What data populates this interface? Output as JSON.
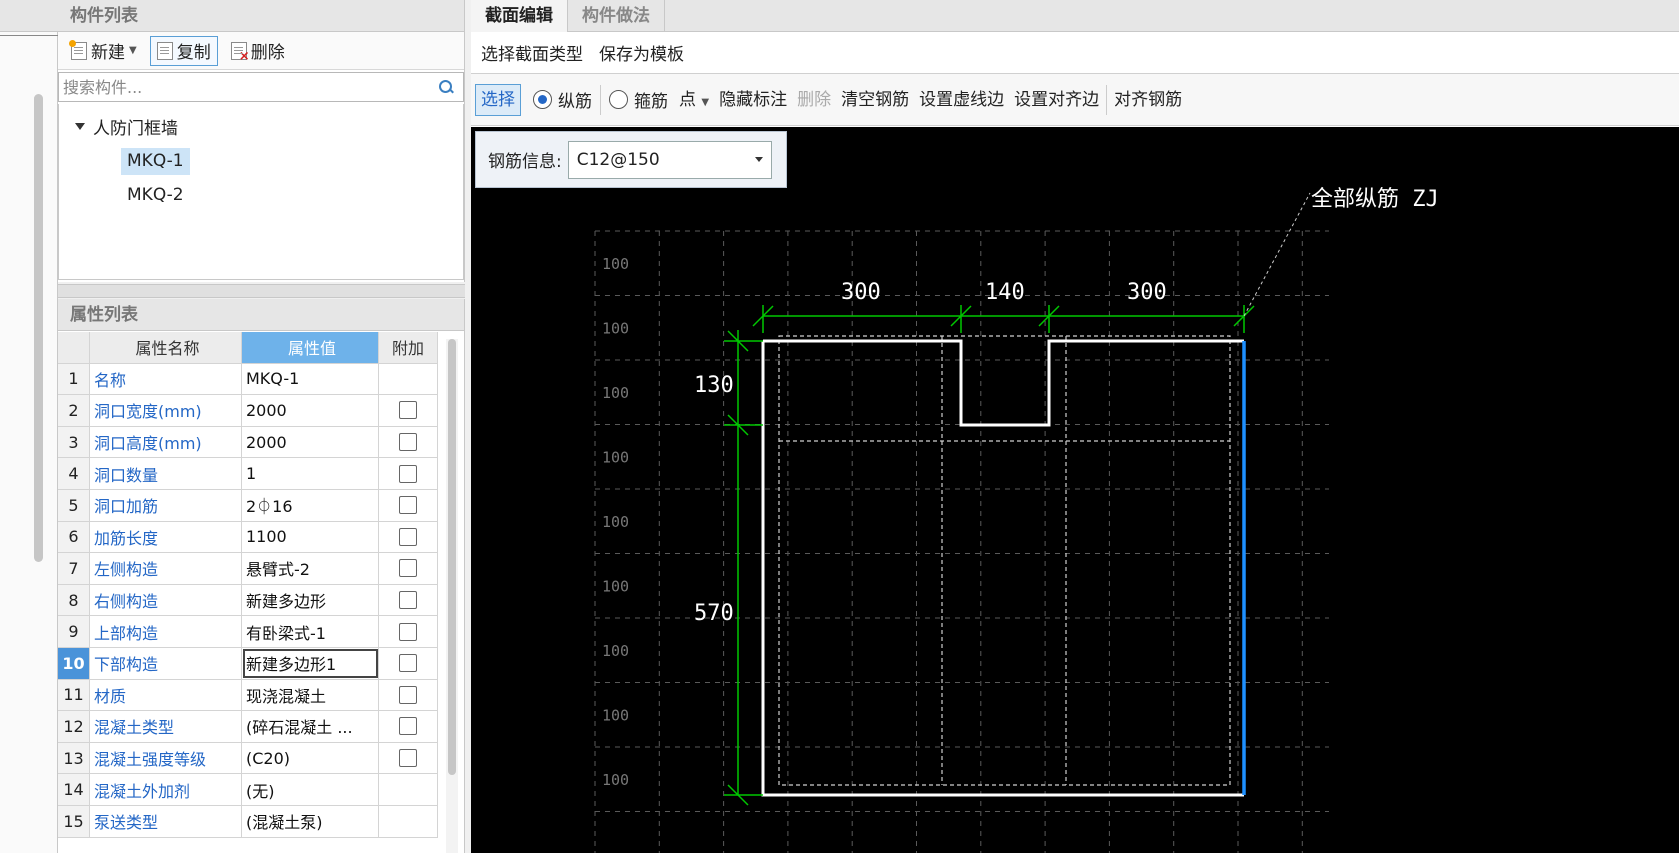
{
  "component_panel": {
    "title": "构件列表",
    "toolbar": {
      "new": "新建",
      "copy": "复制",
      "delete": "删除"
    },
    "search_placeholder": "搜索构件...",
    "tree": {
      "root": "人防门框墙",
      "items": [
        "MKQ-1",
        "MKQ-2"
      ],
      "selected": "MKQ-1"
    }
  },
  "property_panel": {
    "title": "属性列表",
    "headers": {
      "name": "属性名称",
      "value": "属性值",
      "extra": "附加"
    },
    "rows": [
      {
        "num": "1",
        "name": "名称",
        "value": "MKQ-1",
        "has_checkbox": false
      },
      {
        "num": "2",
        "name": "洞口宽度(mm)",
        "value": "2000",
        "has_checkbox": true
      },
      {
        "num": "3",
        "name": "洞口高度(mm)",
        "value": "2000",
        "has_checkbox": true
      },
      {
        "num": "4",
        "name": "洞口数量",
        "value": "1",
        "has_checkbox": true
      },
      {
        "num": "5",
        "name": "洞口加筋",
        "value": "2⏀16",
        "has_checkbox": true
      },
      {
        "num": "6",
        "name": "加筋长度",
        "value": "1100",
        "has_checkbox": true
      },
      {
        "num": "7",
        "name": "左侧构造",
        "value": "悬臂式-2",
        "has_checkbox": true
      },
      {
        "num": "8",
        "name": "右侧构造",
        "value": "新建多边形",
        "has_checkbox": true
      },
      {
        "num": "9",
        "name": "上部构造",
        "value": "有卧梁式-1",
        "has_checkbox": true
      },
      {
        "num": "10",
        "name": "下部构造",
        "value": "新建多边形1",
        "has_checkbox": true
      },
      {
        "num": "11",
        "name": "材质",
        "value": "现浇混凝土",
        "has_checkbox": true
      },
      {
        "num": "12",
        "name": "混凝土类型",
        "value": "(碎石混凝土 ...",
        "has_checkbox": true
      },
      {
        "num": "13",
        "name": "混凝土强度等级",
        "value": "(C20)",
        "has_checkbox": true
      },
      {
        "num": "14",
        "name": "混凝土外加剂",
        "value": "(无)",
        "has_checkbox": false
      },
      {
        "num": "15",
        "name": "泵送类型",
        "value": "(混凝土泵)",
        "has_checkbox": false
      }
    ],
    "active_row": "10"
  },
  "editor": {
    "tabs": [
      "截面编辑",
      "构件做法"
    ],
    "active_tab": "截面编辑",
    "toolbar1": [
      "选择截面类型",
      "保存为模板"
    ],
    "toolbar2": {
      "select": "选择",
      "radio_long": "纵筋",
      "radio_stirrup": "箍筋",
      "point": "点",
      "hide_labels": "隐藏标注",
      "delete": "删除",
      "clear_rebar": "清空钢筋",
      "set_dashed_edge": "设置虚线边",
      "set_align_edge": "设置对齐边",
      "align_rebar": "对齐钢筋"
    },
    "rebar_info": {
      "label": "钢筋信息:",
      "value": "C12@150"
    },
    "drawing": {
      "annotation": "全部纵筋 ZJ",
      "top_dims": [
        "300",
        "140",
        "300"
      ],
      "left_dims": [
        "130",
        "570"
      ],
      "grid_label": "100",
      "colors": {
        "background": "#000000",
        "outline": "#ffffff",
        "dimension": "#00c800",
        "highlight_edge": "#1e90ff",
        "grid": "#5a5a5a"
      }
    }
  }
}
